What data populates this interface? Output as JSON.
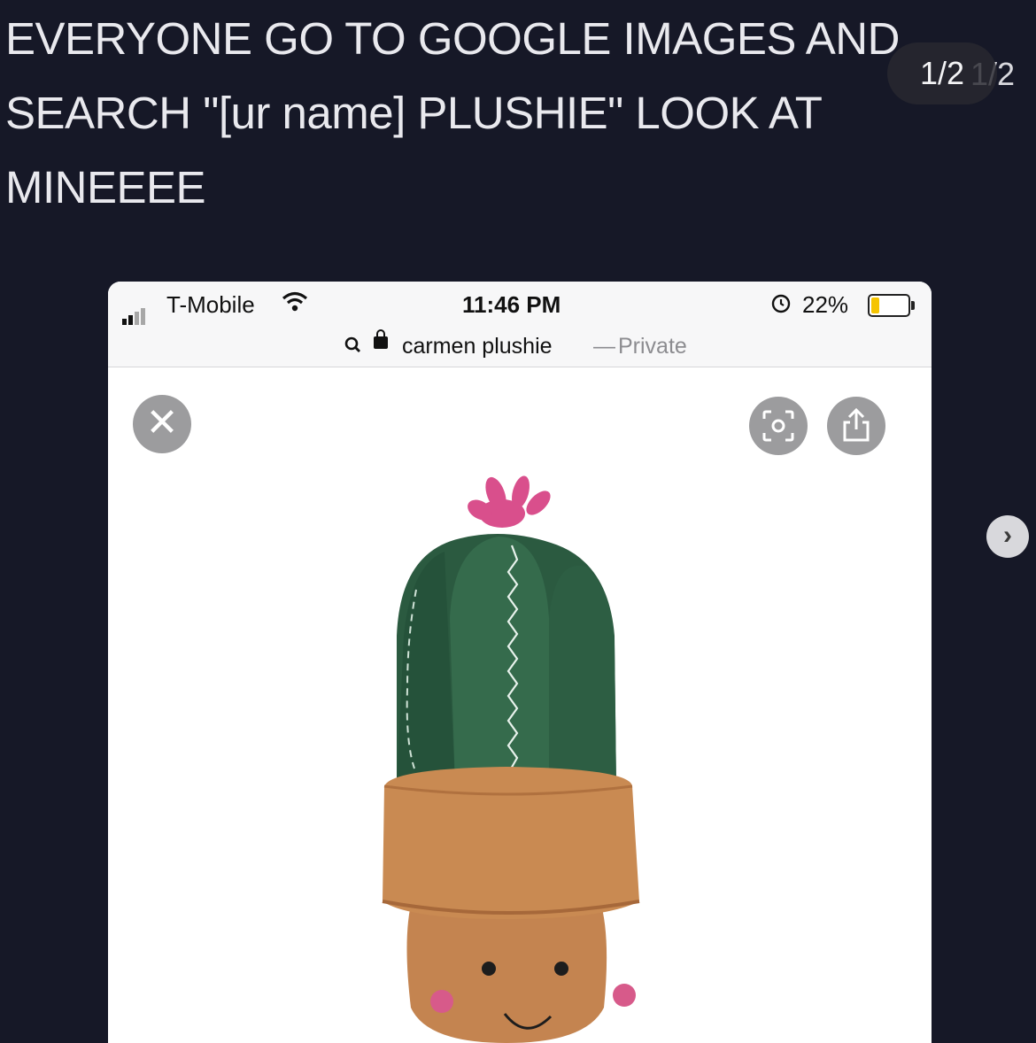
{
  "post": {
    "caption": "EVERYONE GO TO GOOGLE IMAGES AND\nSEARCH \"[ur name] PLUSHIE\" LOOK AT\nMINEEEE",
    "pager": "1/2",
    "pager_ghost": "1/2"
  },
  "phone": {
    "carrier": "T-Mobile",
    "time": "11:46 PM",
    "battery_pct": "22%",
    "battery_level": 0.22,
    "url_text": "carmen plushie",
    "url_dash": "—",
    "url_mode": "Private"
  },
  "icons": {
    "close": "close-icon",
    "lens": "visual-search-icon",
    "share": "share-icon",
    "next": "chevron-right-icon"
  },
  "colors": {
    "background": "#161827",
    "cactus": "#2f5e43",
    "flower": "#d94f8c",
    "pot": "#c98a52"
  }
}
